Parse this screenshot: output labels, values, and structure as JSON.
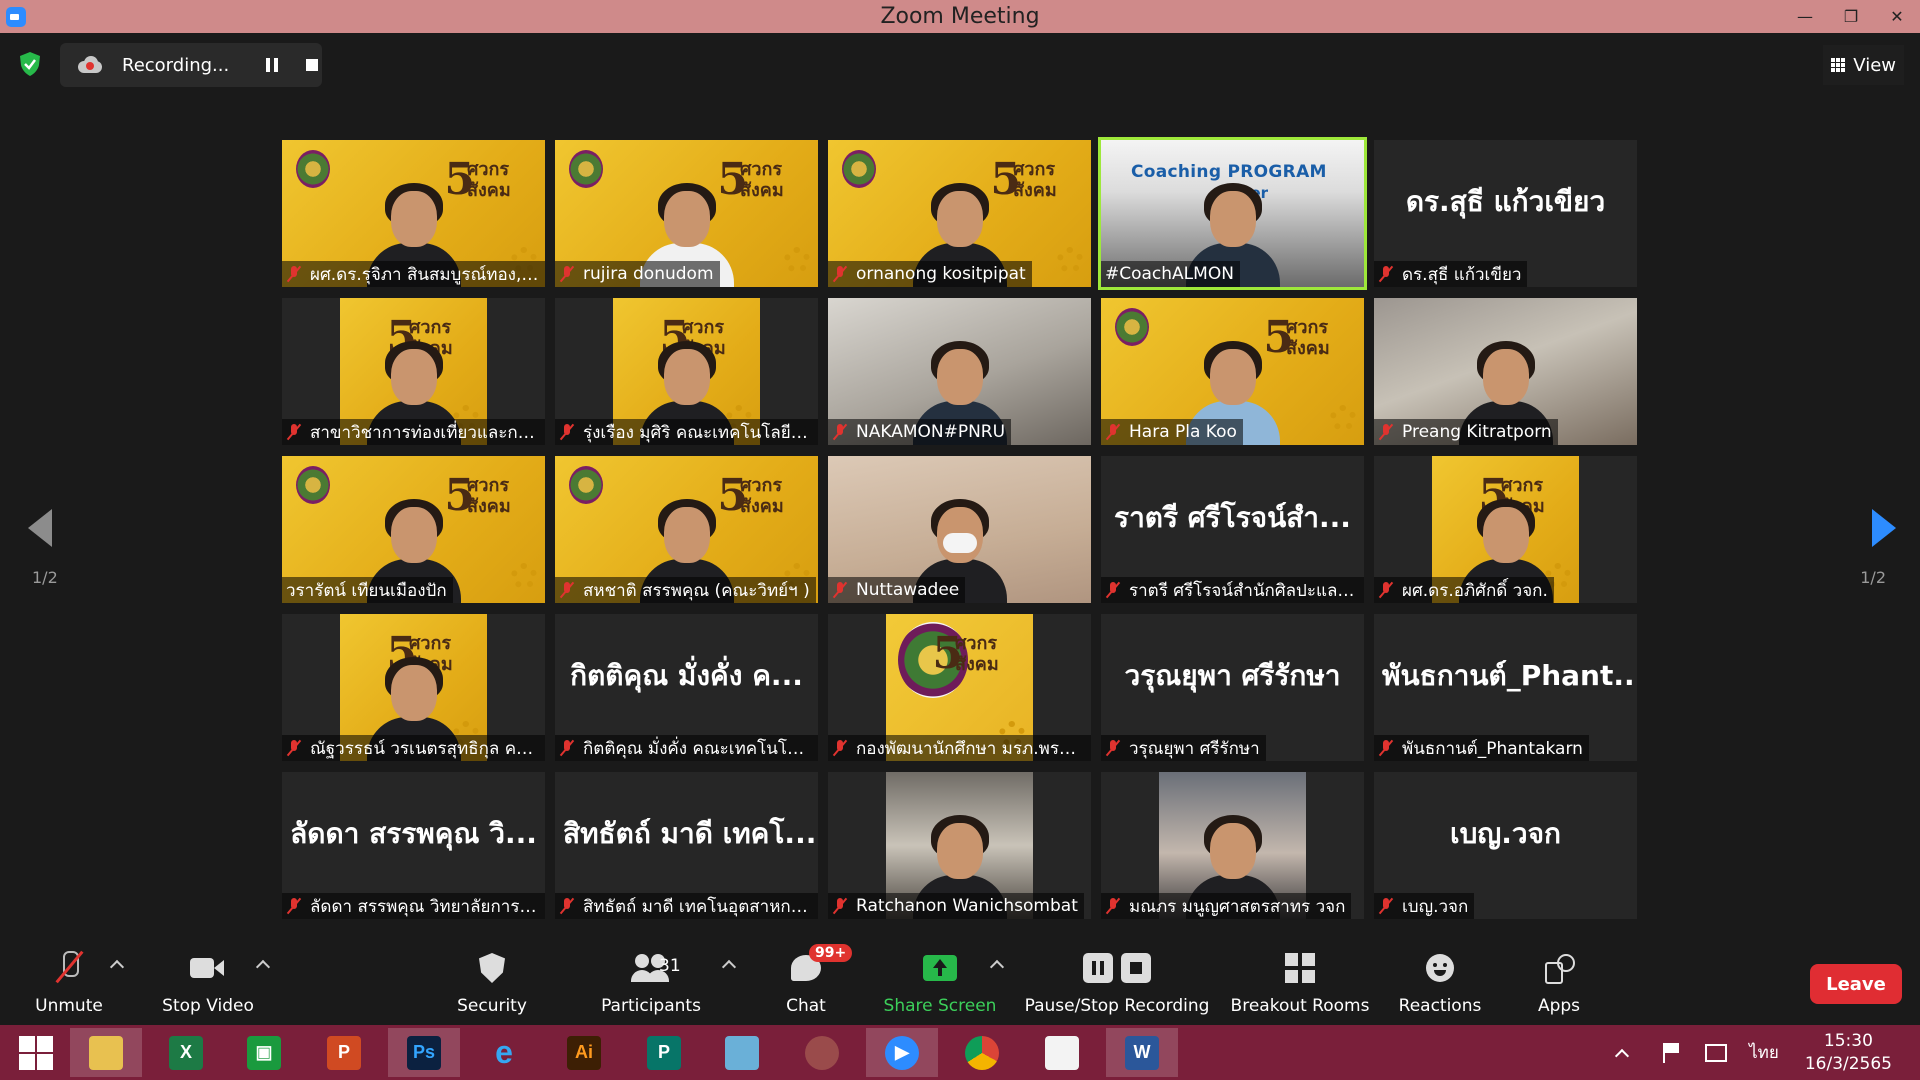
{
  "window": {
    "title": "Zoom Meeting",
    "controls": [
      "—",
      "❐",
      "✕"
    ]
  },
  "topbar": {
    "recording_label": "Recording...",
    "view_label": "View"
  },
  "paging": {
    "left_page": "1/2",
    "right_page": "1/2"
  },
  "participants": [
    {
      "name": "ผศ.ดร.รุจิภา สินสมบูรณ์ทอง, จง...",
      "feed": "yellow",
      "muted": true
    },
    {
      "name": "rujira donudom",
      "feed": "yellow",
      "muted": true
    },
    {
      "name": "ornanong kositpipat",
      "feed": "yellow",
      "muted": true
    },
    {
      "name": "#CoachALMON",
      "feed": "coach",
      "muted": false,
      "active_speaker": true,
      "banner_title": "Coaching PROGRAM",
      "banner_sub": "for er"
    },
    {
      "name": "ดร.สุธี แก้วเขียว",
      "feed": "none",
      "display_name": "ดร.สุธี  แก้วเขียว",
      "muted": true
    },
    {
      "name": "สาขาวิชาการท่องเที่ยวและการโร...",
      "feed": "yellow-inset",
      "muted": true
    },
    {
      "name": "รุ่งเรือง มุศิริ คณะเทคโนโลยีอุตส...",
      "feed": "yellow-inset",
      "muted": true
    },
    {
      "name": "NAKAMON#PNRU",
      "feed": "office",
      "muted": true
    },
    {
      "name": "Hara Pla Koo",
      "feed": "yellow",
      "muted": true
    },
    {
      "name": "Preang Kitratporn",
      "feed": "room",
      "muted": true
    },
    {
      "name": "วรารัตน์ เทียนเมืองปัก",
      "feed": "yellow",
      "muted": false
    },
    {
      "name": "สหชาติ สรรพคุณ (คณะวิทย์ฯ )",
      "feed": "yellow",
      "muted": true
    },
    {
      "name": "Nuttawadee",
      "feed": "beige",
      "muted": true
    },
    {
      "name": "ราตรี  ศรีโรจน์สำนักศิลปะและวั...",
      "feed": "none",
      "display_name": "ราตรี  ศรีโรจน์สำ...",
      "muted": true
    },
    {
      "name": "ผศ.ดร.อภิศักดิ์ วจก.",
      "feed": "yellow-inset",
      "muted": true
    },
    {
      "name": "ณัฐวรรธน์ วรเนตรสุทธิกุล คณะ...",
      "feed": "yellow-inset",
      "muted": true
    },
    {
      "name": "กิตติคุณ  มั่งคั่ง คณะเทคโนโลยีอ...",
      "feed": "none",
      "display_name": "กิตติคุณ  มั่งคั่ง ค...",
      "muted": true
    },
    {
      "name": "กองพัฒนานักศึกษา มรภ.พระนคร",
      "feed": "logo-inset",
      "muted": true
    },
    {
      "name": "วรุณยุพา ศรีรักษา",
      "feed": "none",
      "display_name": "วรุณยุพา ศรีรักษา",
      "muted": true
    },
    {
      "name": "พันธกานต์_Phantakarn",
      "feed": "none",
      "display_name": "พันธกานต์_Phant...",
      "muted": true
    },
    {
      "name": "ลัดดา สรรพคุณ วิทยาลัยการฝึ...",
      "feed": "none",
      "display_name": "ลัดดา สรรพคุณ วิ...",
      "muted": true
    },
    {
      "name": "สิทธัตถ์ มาดี เทคโนอุตสาหกรรม",
      "feed": "none",
      "display_name": "สิทธัตถ์ มาดี เทคโ...",
      "muted": true
    },
    {
      "name": "Ratchanon Wanichsombat",
      "feed": "market-inset",
      "muted": true
    },
    {
      "name": "มณภร มนูญศาสตรสาทร วจก",
      "feed": "portrait-inset",
      "muted": true
    },
    {
      "name": "เบญ.วจก",
      "feed": "none",
      "display_name": "เบญ.วจก",
      "muted": true
    }
  ],
  "banner": {
    "number": "5",
    "word": "ศวกร สังคม"
  },
  "toolbar": {
    "unmute": "Unmute",
    "stop_video": "Stop Video",
    "security": "Security",
    "participants": "Participants",
    "participant_count": "31",
    "chat": "Chat",
    "chat_badge": "99+",
    "share_screen": "Share Screen",
    "pause_stop_recording": "Pause/Stop Recording",
    "breakout_rooms": "Breakout Rooms",
    "reactions": "Reactions",
    "apps": "Apps",
    "leave": "Leave"
  },
  "taskbar": {
    "apps": [
      "start",
      "file-explorer",
      "excel",
      "publisher-green",
      "powerpoint",
      "photoshop",
      "internet-explorer",
      "illustrator",
      "publisher",
      "notepad-blue",
      "photoscape",
      "zoom",
      "chrome",
      "photos",
      "word"
    ],
    "language": "ไทย",
    "time": "15:30",
    "date": "16/3/2565"
  },
  "colors": {
    "title_bar": "#cf8a8a",
    "taskbar": "#7a1f3a",
    "active_speaker": "#9ee83a",
    "share_green": "#27b94a",
    "leave_red": "#e02d33",
    "page_arrow": "#2d8cff"
  }
}
